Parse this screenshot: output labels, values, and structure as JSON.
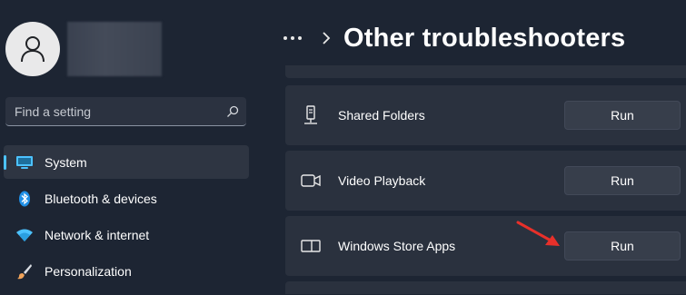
{
  "sidebar": {
    "search": {
      "placeholder": "Find a setting"
    },
    "items": [
      {
        "label": "System",
        "icon": "monitor-icon",
        "active": true
      },
      {
        "label": "Bluetooth & devices",
        "icon": "bluetooth-icon",
        "active": false
      },
      {
        "label": "Network & internet",
        "icon": "wifi-icon",
        "active": false
      },
      {
        "label": "Personalization",
        "icon": "brush-icon",
        "active": false
      }
    ]
  },
  "header": {
    "title": "Other troubleshooters"
  },
  "troubleshooters": [
    {
      "label": "Shared Folders",
      "icon": "shared-folder-icon",
      "button": "Run"
    },
    {
      "label": "Video Playback",
      "icon": "video-camera-icon",
      "button": "Run"
    },
    {
      "label": "Windows Store Apps",
      "icon": "store-apps-icon",
      "button": "Run"
    }
  ],
  "colors": {
    "accent": "#4cc2ff",
    "background": "#1d2533",
    "card": "#2a313e",
    "annotation_arrow": "#e8302a"
  }
}
